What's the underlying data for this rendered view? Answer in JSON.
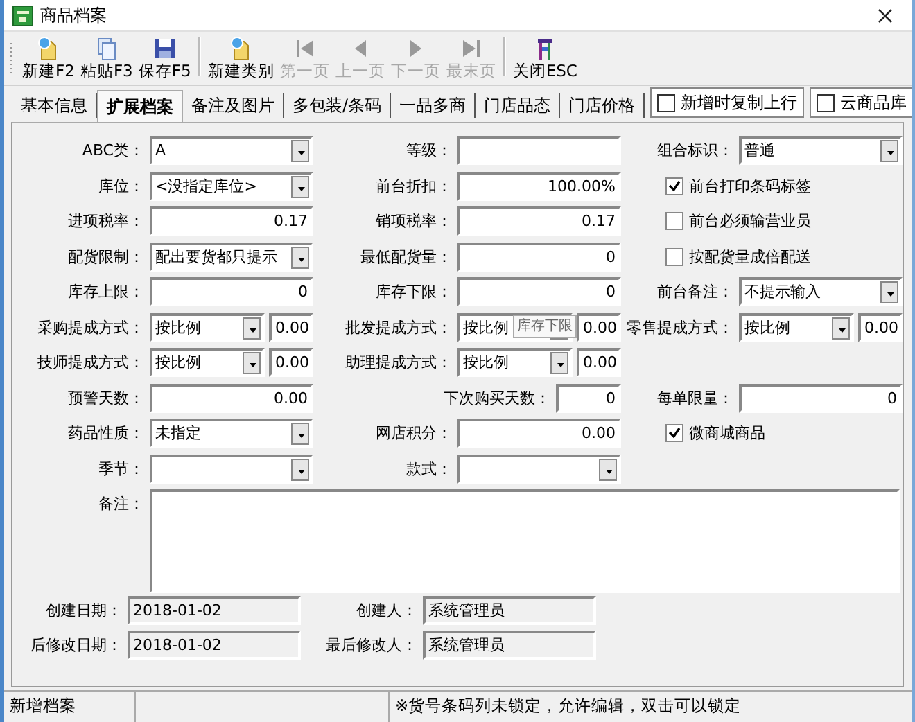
{
  "window": {
    "title": "商品档案"
  },
  "toolbar": [
    {
      "label": "新建F2",
      "kind": "new",
      "disabled": false,
      "group_start": false
    },
    {
      "label": "粘贴F3",
      "kind": "paste",
      "disabled": false,
      "group_start": false
    },
    {
      "label": "保存F5",
      "kind": "save",
      "disabled": false,
      "group_start": false
    },
    {
      "label": "新建类别",
      "kind": "new",
      "disabled": false,
      "group_start": true
    },
    {
      "label": "第一页",
      "kind": "first",
      "disabled": true,
      "group_start": false
    },
    {
      "label": "上一页",
      "kind": "prev",
      "disabled": true,
      "group_start": false
    },
    {
      "label": "下一页",
      "kind": "next",
      "disabled": true,
      "group_start": false
    },
    {
      "label": "最末页",
      "kind": "last",
      "disabled": true,
      "group_start": false
    },
    {
      "label": "关闭ESC",
      "kind": "exit",
      "disabled": false,
      "group_start": true
    }
  ],
  "tabs": [
    {
      "label": "基本信息",
      "selected": false
    },
    {
      "label": "扩展档案",
      "selected": true
    },
    {
      "label": "备注及图片",
      "selected": false
    },
    {
      "label": "多包装/条码",
      "selected": false
    },
    {
      "label": "一品多商",
      "selected": false
    },
    {
      "label": "门店品态",
      "selected": false
    },
    {
      "label": "门店价格",
      "selected": false
    }
  ],
  "tab_options": [
    {
      "label": "新增时复制上行",
      "checked": false
    },
    {
      "label": "云商品库",
      "checked": false
    }
  ],
  "form_rows": [
    [
      {
        "kind": "select",
        "label": "ABC类：",
        "value": "A"
      },
      {
        "kind": "text",
        "label": "等级："
      },
      {
        "kind": "select",
        "label": "组合标识：",
        "value": "普通"
      }
    ],
    [
      {
        "kind": "select",
        "label": "库位：",
        "value": "<没指定库位>"
      },
      {
        "kind": "number",
        "label": "前台折扣：",
        "value": "100.00%"
      },
      {
        "kind": "check",
        "label": "前台打印条码标签",
        "checked": true
      }
    ],
    [
      {
        "kind": "number",
        "label": "进项税率：",
        "value": "0.17"
      },
      {
        "kind": "number",
        "label": "销项税率：",
        "value": "0.17"
      },
      {
        "kind": "check",
        "label": "前台必须输营业员",
        "checked": false
      }
    ],
    [
      {
        "kind": "select",
        "label": "配货限制：",
        "value": "配出要货都只提示"
      },
      {
        "kind": "number",
        "label": "最低配货量：",
        "value": "0"
      },
      {
        "kind": "check",
        "label": "按配货量成倍配送",
        "checked": false
      }
    ],
    [
      {
        "kind": "number",
        "label": "库存上限：",
        "value": "0"
      },
      {
        "kind": "number",
        "label": "库存下限：",
        "value": "0"
      },
      {
        "kind": "select",
        "label": "前台备注：",
        "value": "不提示输入"
      }
    ],
    [
      {
        "kind": "select_num",
        "label": "采购提成方式：",
        "value": "按比例",
        "amount": "0.00"
      },
      {
        "kind": "select_num",
        "label": "批发提成方式：",
        "value": "按比例",
        "amount": "0.00"
      },
      {
        "kind": "select_num",
        "label": "零售提成方式：",
        "value": "按比例",
        "amount": "0.00"
      }
    ],
    [
      {
        "kind": "select_num",
        "label": "技师提成方式：",
        "value": "按比例",
        "amount": "0.00"
      },
      {
        "kind": "select_num",
        "label": "助理提成方式：",
        "value": "按比例",
        "amount": "0.00"
      },
      {
        "kind": "blank"
      }
    ],
    [
      {
        "kind": "number",
        "label": "预警天数：",
        "value": "0.00"
      },
      {
        "kind": "short_number",
        "label": "下次购买天数：",
        "value": "0"
      },
      {
        "kind": "number",
        "label": "每单限量：",
        "value": "0"
      }
    ],
    [
      {
        "kind": "select",
        "label": "药品性质：",
        "value": "未指定"
      },
      {
        "kind": "number",
        "label": "网店积分：",
        "value": "0.00"
      },
      {
        "kind": "check",
        "label": "微商城商品",
        "checked": true
      }
    ],
    [
      {
        "kind": "select",
        "label": "季节："
      },
      {
        "kind": "select",
        "label": "款式："
      },
      {
        "kind": "blank"
      }
    ]
  ],
  "remarks": {
    "label": "备注："
  },
  "audit": [
    [
      {
        "label": "创建日期：",
        "value": "2018-01-02"
      },
      {
        "label": "创建人：",
        "value": "系统管理员"
      }
    ],
    [
      {
        "label": "后修改日期：",
        "value": "2018-01-02"
      },
      {
        "label": "最后修改人：",
        "value": "系统管理员"
      }
    ]
  ],
  "tooltip": "库存下限",
  "status_bar": [
    "新增档案",
    "※货号条码列未锁定，允许编辑，双击可以锁定"
  ]
}
